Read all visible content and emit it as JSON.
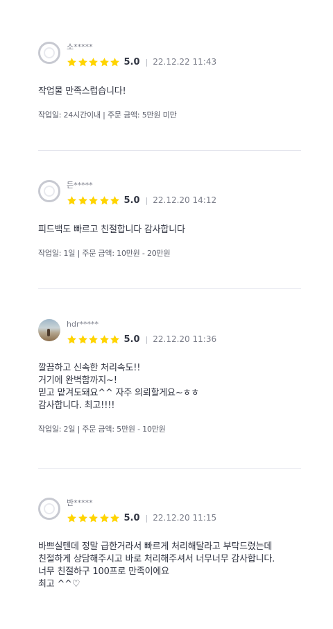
{
  "reviews": [
    {
      "name": "소*****",
      "rating": 5,
      "score": "5.0",
      "separator": "|",
      "date": "22.12.22 11:43",
      "text": "작업물 만족스럽습니다!",
      "info": "작업일: 24시간이내 | 주문 금액: 5만원 미만"
    },
    {
      "name": "든*****",
      "rating": 5,
      "score": "5.0",
      "separator": "|",
      "date": "22.12.20 14:12",
      "text": "피드백도 빠르고 친절합니다 감사합니다",
      "info": "작업일: 1일 | 주문 금액: 10만원 - 20만원"
    },
    {
      "name": "hdr*****",
      "rating": 5,
      "score": "5.0",
      "separator": "|",
      "date": "22.12.20 11:36",
      "text": "깔끔하고 신속한 처리속도!!\n거기에 완벽함까지~!\n믿고 맡겨도돼요^^ 자주 의뢰할게요~ㅎㅎ\n감사합니다. 최고!!!!",
      "info": "작업일: 2일 | 주문 금액: 5만원 - 10만원"
    },
    {
      "name": "반*****",
      "rating": 5,
      "score": "5.0",
      "separator": "|",
      "date": "22.12.20 11:15",
      "text": "바쁘실텐데 정말 급한거라서 빠르게 처리해달라고 부탁드렸는데\n친절하게 상담해주시고 바로 처리해주셔서 너무너무 감사합니다.\n너무 친절하구 100프로 만족이에요\n최고 ^^♡",
      "info": ""
    }
  ],
  "colors": {
    "star": "#ffd400",
    "divider": "#e4e5ed"
  }
}
